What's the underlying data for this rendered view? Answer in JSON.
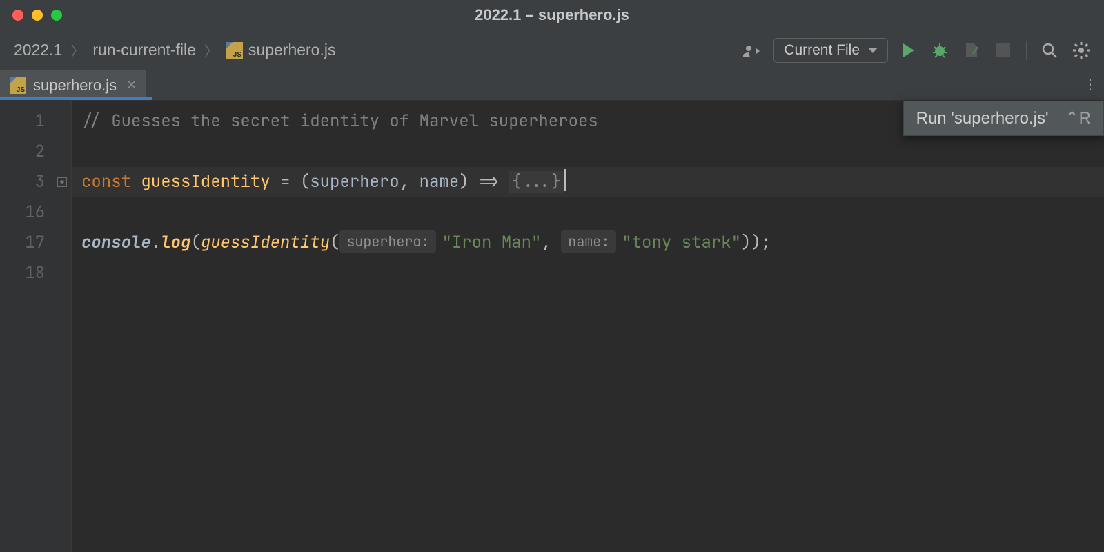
{
  "window": {
    "title": "2022.1 – superhero.js"
  },
  "breadcrumbs": {
    "items": [
      "2022.1",
      "run-current-file",
      "superhero.js"
    ]
  },
  "runConfig": {
    "label": "Current File"
  },
  "tab": {
    "label": "superhero.js"
  },
  "tooltip": {
    "text": "Run 'superhero.js'",
    "shortcut": "⌃R"
  },
  "gutter": {
    "lines": [
      "1",
      "2",
      "3",
      "16",
      "17",
      "18"
    ]
  },
  "code": {
    "line1_comment": "// Guesses the secret identity of Marvel superheroes",
    "line3": {
      "kw": "const ",
      "fn": "guessIdentity",
      "eq": " = (",
      "p1": "superhero",
      "comma": ", ",
      "p2": "name",
      "close": ") => ",
      "fold": "{...}"
    },
    "line17": {
      "obj": "console",
      "dot": ".",
      "log": "log",
      "open": "(",
      "call": "guessIdentity",
      "open2": "(",
      "hint1": "superhero:",
      "str1": "\"Iron Man\"",
      "comma": ", ",
      "hint2": "name:",
      "str2": "\"tony stark\"",
      "end": "));"
    }
  },
  "icons": {
    "js": "JS"
  }
}
